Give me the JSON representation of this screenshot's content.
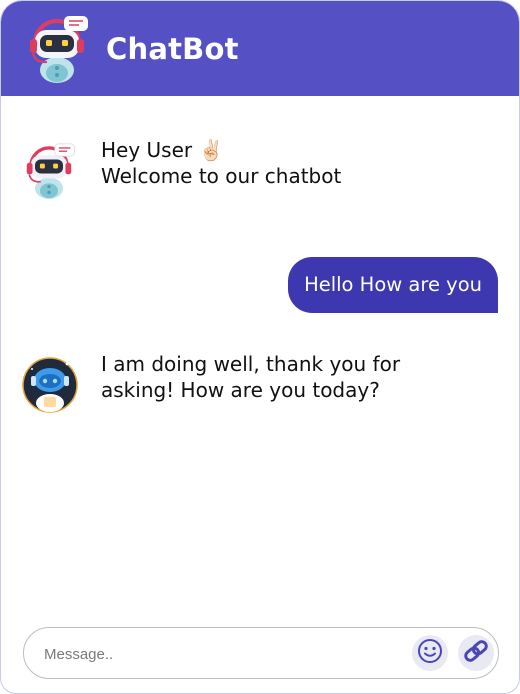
{
  "header": {
    "title": "ChatBot",
    "avatar_icon": "robot-headset-icon"
  },
  "messages": [
    {
      "sender": "bot",
      "avatar_icon": "robot-headset-icon",
      "lines": [
        "Hey User ✌🏻",
        "Welcome to our chatbot"
      ]
    },
    {
      "sender": "user",
      "text": "Hello How are you"
    },
    {
      "sender": "bot",
      "avatar_icon": "robot-astronaut-icon",
      "lines": [
        "I am doing well, thank you for",
        "asking! How are you today?"
      ]
    }
  ],
  "composer": {
    "placeholder": "Message..",
    "emoji_icon": "smiley-icon",
    "attach_icon": "link-icon"
  },
  "colors": {
    "header_bg": "#5551c5",
    "user_bubble_bg": "#3e38b0",
    "icon_color": "#4b46b8"
  }
}
